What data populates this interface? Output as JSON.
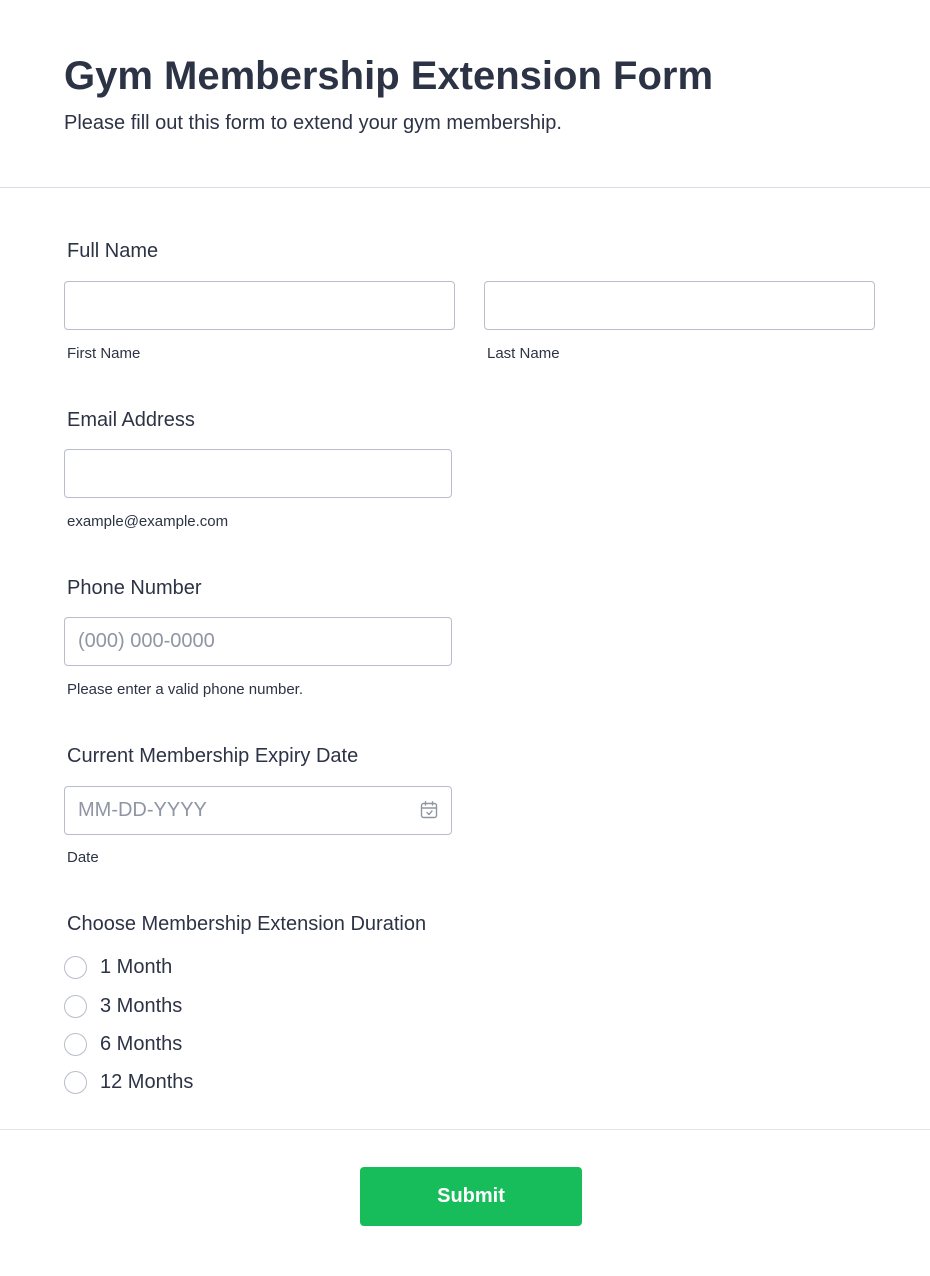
{
  "header": {
    "title": "Gym Membership Extension Form",
    "subtitle": "Please fill out this form to extend your gym membership."
  },
  "full_name": {
    "label": "Full Name",
    "first": {
      "value": "",
      "sublabel": "First Name"
    },
    "last": {
      "value": "",
      "sublabel": "Last Name"
    }
  },
  "email": {
    "label": "Email Address",
    "value": "",
    "sublabel": "example@example.com"
  },
  "phone": {
    "label": "Phone Number",
    "value": "",
    "placeholder": "(000) 000-0000",
    "sublabel": "Please enter a valid phone number."
  },
  "expiry_date": {
    "label": "Current Membership Expiry Date",
    "value": "",
    "placeholder": "MM-DD-YYYY",
    "sublabel": "Date",
    "icon": "calendar-icon"
  },
  "duration": {
    "label": "Choose Membership Extension Duration",
    "options": [
      "1 Month",
      "3 Months",
      "6 Months",
      "12 Months"
    ],
    "selected": null
  },
  "footer": {
    "submit_label": "Submit"
  },
  "colors": {
    "text": "#2c3345",
    "border": "#b8bdc9",
    "placeholder": "#8f96a3",
    "submit": "#18bd5b"
  }
}
